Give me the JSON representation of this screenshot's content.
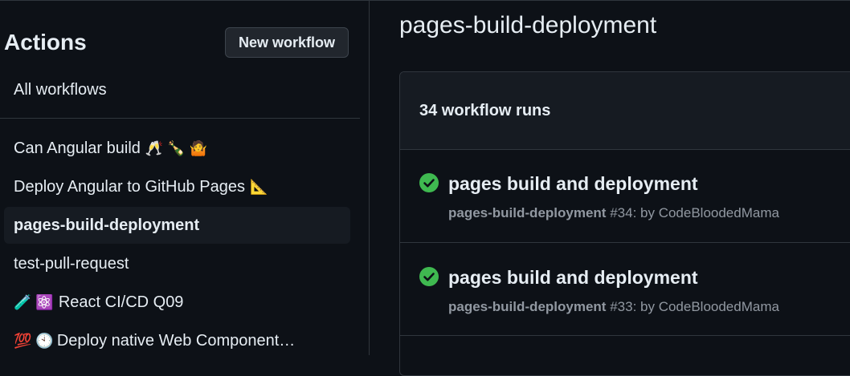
{
  "sidebar": {
    "title": "Actions",
    "new_workflow_label": "New workflow",
    "all_workflows_label": "All workflows",
    "items": [
      {
        "label": "Can Angular build",
        "emoji": "🥂 🍾 🤷"
      },
      {
        "label": "Deploy Angular to GitHub Pages",
        "emoji": "📐"
      },
      {
        "label": "pages-build-deployment",
        "emoji": ""
      },
      {
        "label": "test-pull-request",
        "emoji": ""
      },
      {
        "label": "React CI/CD Q09",
        "prefix": "🧪 ⚛️"
      },
      {
        "label": "Deploy native Web Component…",
        "prefix": "💯 🕙"
      }
    ],
    "active_index": 2
  },
  "main": {
    "page_title": "pages-build-deployment",
    "run_count_label": "34 workflow runs",
    "runs": [
      {
        "title": "pages build and deployment",
        "workflow": "pages-build-deployment",
        "meta": "#34: by CodeBloodedMama",
        "status": "success"
      },
      {
        "title": "pages build and deployment",
        "workflow": "pages-build-deployment",
        "meta": "#33: by CodeBloodedMama",
        "status": "success"
      }
    ]
  },
  "colors": {
    "background": "#0d1117",
    "success": "#3fb950",
    "muted_text": "#9198a1",
    "border": "#30363d"
  }
}
